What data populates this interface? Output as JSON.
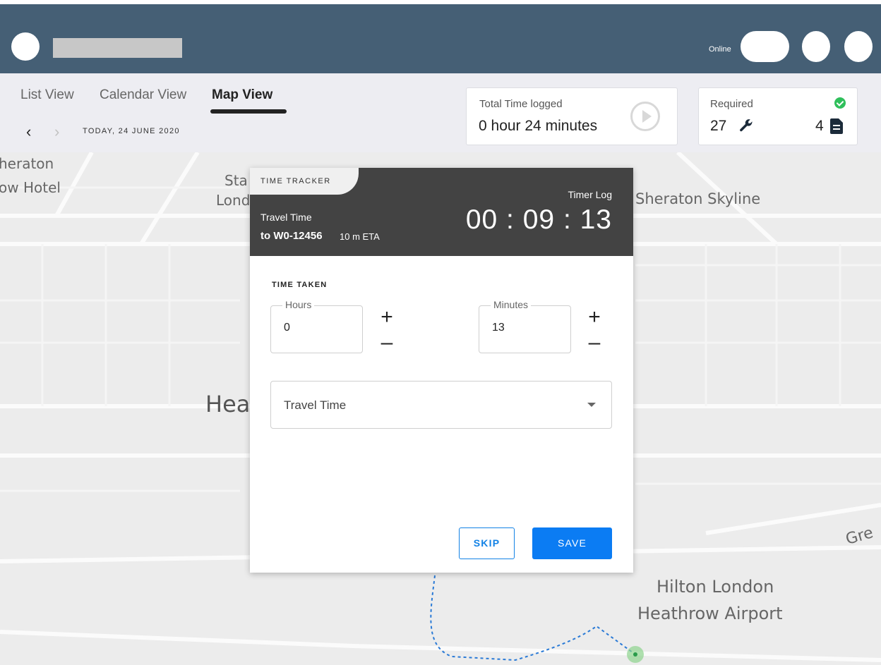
{
  "topbar": {
    "status_label": "Online",
    "colors": {
      "background": "#455f75"
    }
  },
  "views": {
    "tabs": [
      {
        "label": "List View",
        "active": false
      },
      {
        "label": "Calendar View",
        "active": false
      },
      {
        "label": "Map View",
        "active": true
      }
    ],
    "date_label": "TODAY, 24 JUNE 2020"
  },
  "summary": {
    "total_time_label": "Total Time logged",
    "total_time_value": "0 hour 24 minutes",
    "required_label": "Required",
    "required_count": "27",
    "docs_count": "4"
  },
  "map": {
    "labels": [
      "heraton",
      "ow Hotel",
      "Sta",
      "Lond",
      "Sheraton Skyline",
      "Hea",
      "Gre",
      "Hilton London",
      "Heathrow Airport"
    ]
  },
  "tracker": {
    "tab_label": "TIME TRACKER",
    "timer_log_label": "Timer Log",
    "timer_value": "00 : 09 : 13",
    "travel_time_label": "Travel Time",
    "destination": "to W0-12456",
    "eta": "10 m ETA",
    "time_taken_label": "TIME TAKEN",
    "hours": {
      "label": "Hours",
      "value": "0"
    },
    "minutes": {
      "label": "Minutes",
      "value": "13"
    },
    "category": {
      "selected": "Travel Time"
    },
    "skip_label": "SKIP",
    "save_label": "SAVE",
    "colors": {
      "header": "#434343",
      "primary": "#0b7cf3"
    }
  }
}
